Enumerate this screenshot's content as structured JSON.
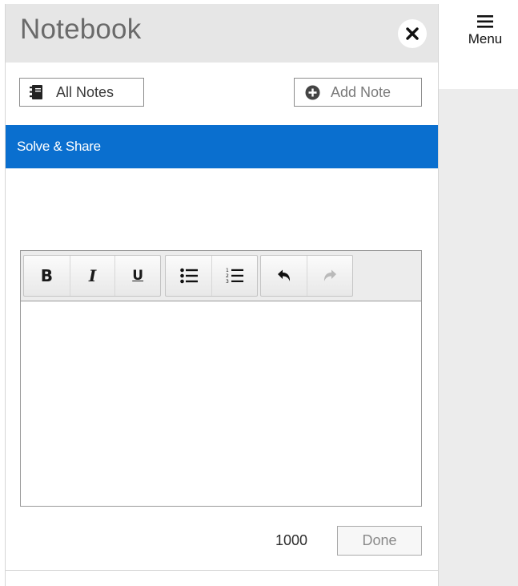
{
  "panel": {
    "title": "Notebook",
    "close_icon": "close-icon"
  },
  "toolbar": {
    "all_notes_label": "All Notes",
    "all_notes_icon": "notebook-icon",
    "add_note_label": "Add Note",
    "add_note_icon": "plus-circle-icon"
  },
  "section": {
    "label": "Solve & Share",
    "color": "#0a6fcf"
  },
  "editor": {
    "tools": [
      {
        "name": "bold",
        "label": "B"
      },
      {
        "name": "italic",
        "label": "I"
      },
      {
        "name": "underline",
        "label": "U"
      },
      {
        "name": "bullet-list",
        "icon": "bullet-list-icon"
      },
      {
        "name": "numbered-list",
        "icon": "numbered-list-icon"
      },
      {
        "name": "undo",
        "icon": "undo-icon"
      },
      {
        "name": "redo",
        "icon": "redo-icon",
        "disabled": true
      }
    ],
    "content": "",
    "char_count": "1000",
    "done_label": "Done"
  },
  "menu": {
    "label": "Menu",
    "icon": "hamburger-icon"
  }
}
